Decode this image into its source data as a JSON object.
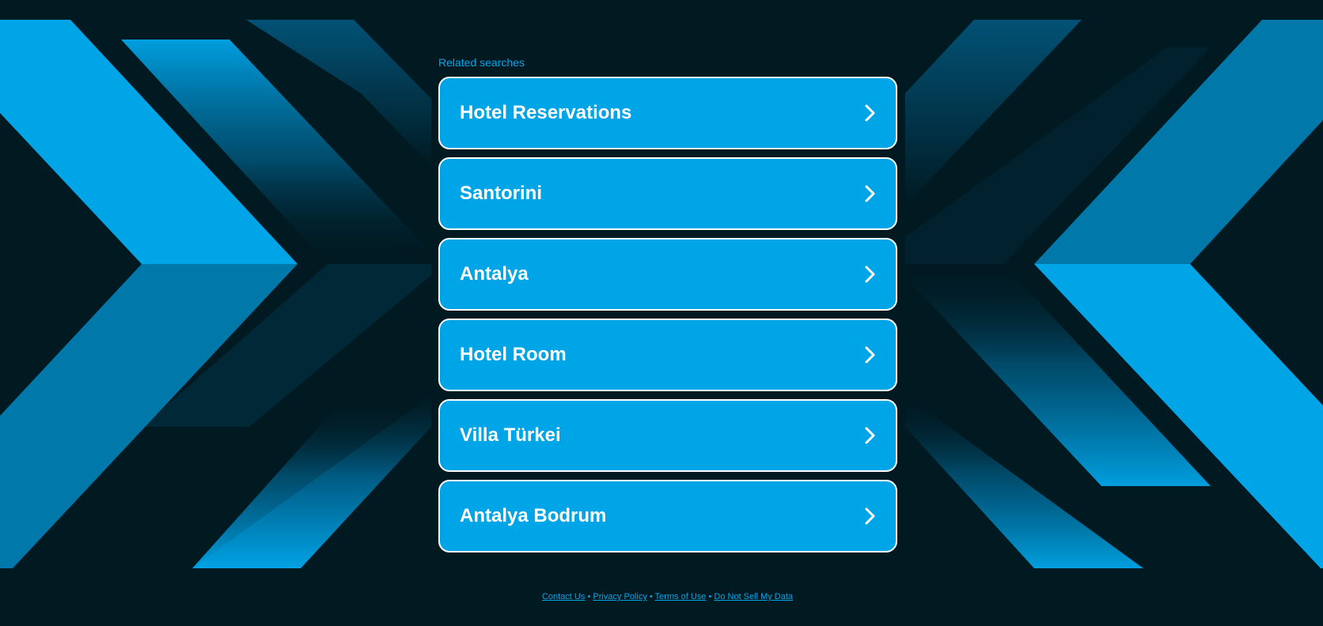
{
  "related_searches": {
    "label": "Related searches",
    "items": [
      {
        "label": "Hotel Reservations",
        "icon": "chevron-right-icon"
      },
      {
        "label": "Santorini",
        "icon": "chevron-right-icon"
      },
      {
        "label": "Antalya",
        "icon": "chevron-right-icon"
      },
      {
        "label": "Hotel Room",
        "icon": "chevron-right-icon"
      },
      {
        "label": "Villa Türkei",
        "icon": "chevron-right-icon"
      },
      {
        "label": "Antalya Bodrum",
        "icon": "chevron-right-icon"
      }
    ]
  },
  "footer": {
    "links": [
      "Contact Us",
      "Privacy Policy",
      "Terms of Use",
      "Do Not Sell My Data"
    ],
    "separator": "•"
  },
  "colors": {
    "background": "#011a22",
    "accent": "#00a5e8",
    "accent_dark": "#0078a8",
    "button_border": "#ffffff",
    "text_on_accent": "#ffffff"
  }
}
